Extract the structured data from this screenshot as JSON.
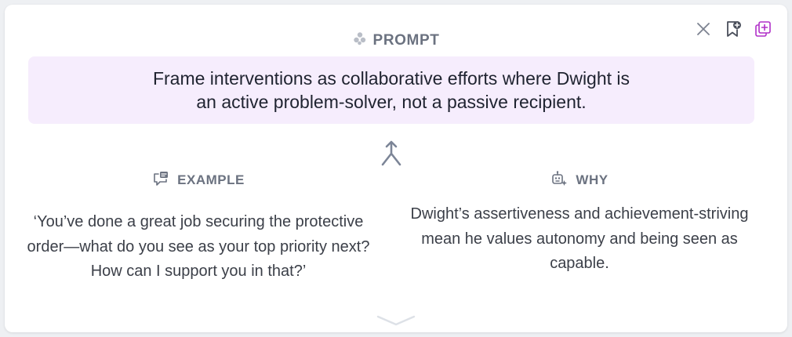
{
  "prompt": {
    "title": "PROMPT",
    "text": "Frame interventions as collaborative efforts where Dwight is an active problem-solver, not a passive recipient."
  },
  "example": {
    "title": "EXAMPLE",
    "text": "‘You’ve done a great job securing the protective order—what do you see as your top priority next? How can I support you in that?’"
  },
  "why": {
    "title": "WHY",
    "text": "Dwight’s assertiveness and achievement-striving mean he values autonomy and being seen as capable."
  },
  "icons": {
    "prompt": "dots-cluster-icon",
    "close": "close-icon",
    "bookmark": "bookmark-add-icon",
    "copy": "copy-add-icon",
    "merge": "merge-arrow-icon",
    "example": "chat-bubble-icon",
    "why": "robot-sparkle-icon",
    "scroll": "chevron-down-icon"
  },
  "colors": {
    "prompt_bg": "#f6edfd",
    "accent_purple": "#b030c8",
    "muted_text": "#6b7280"
  }
}
